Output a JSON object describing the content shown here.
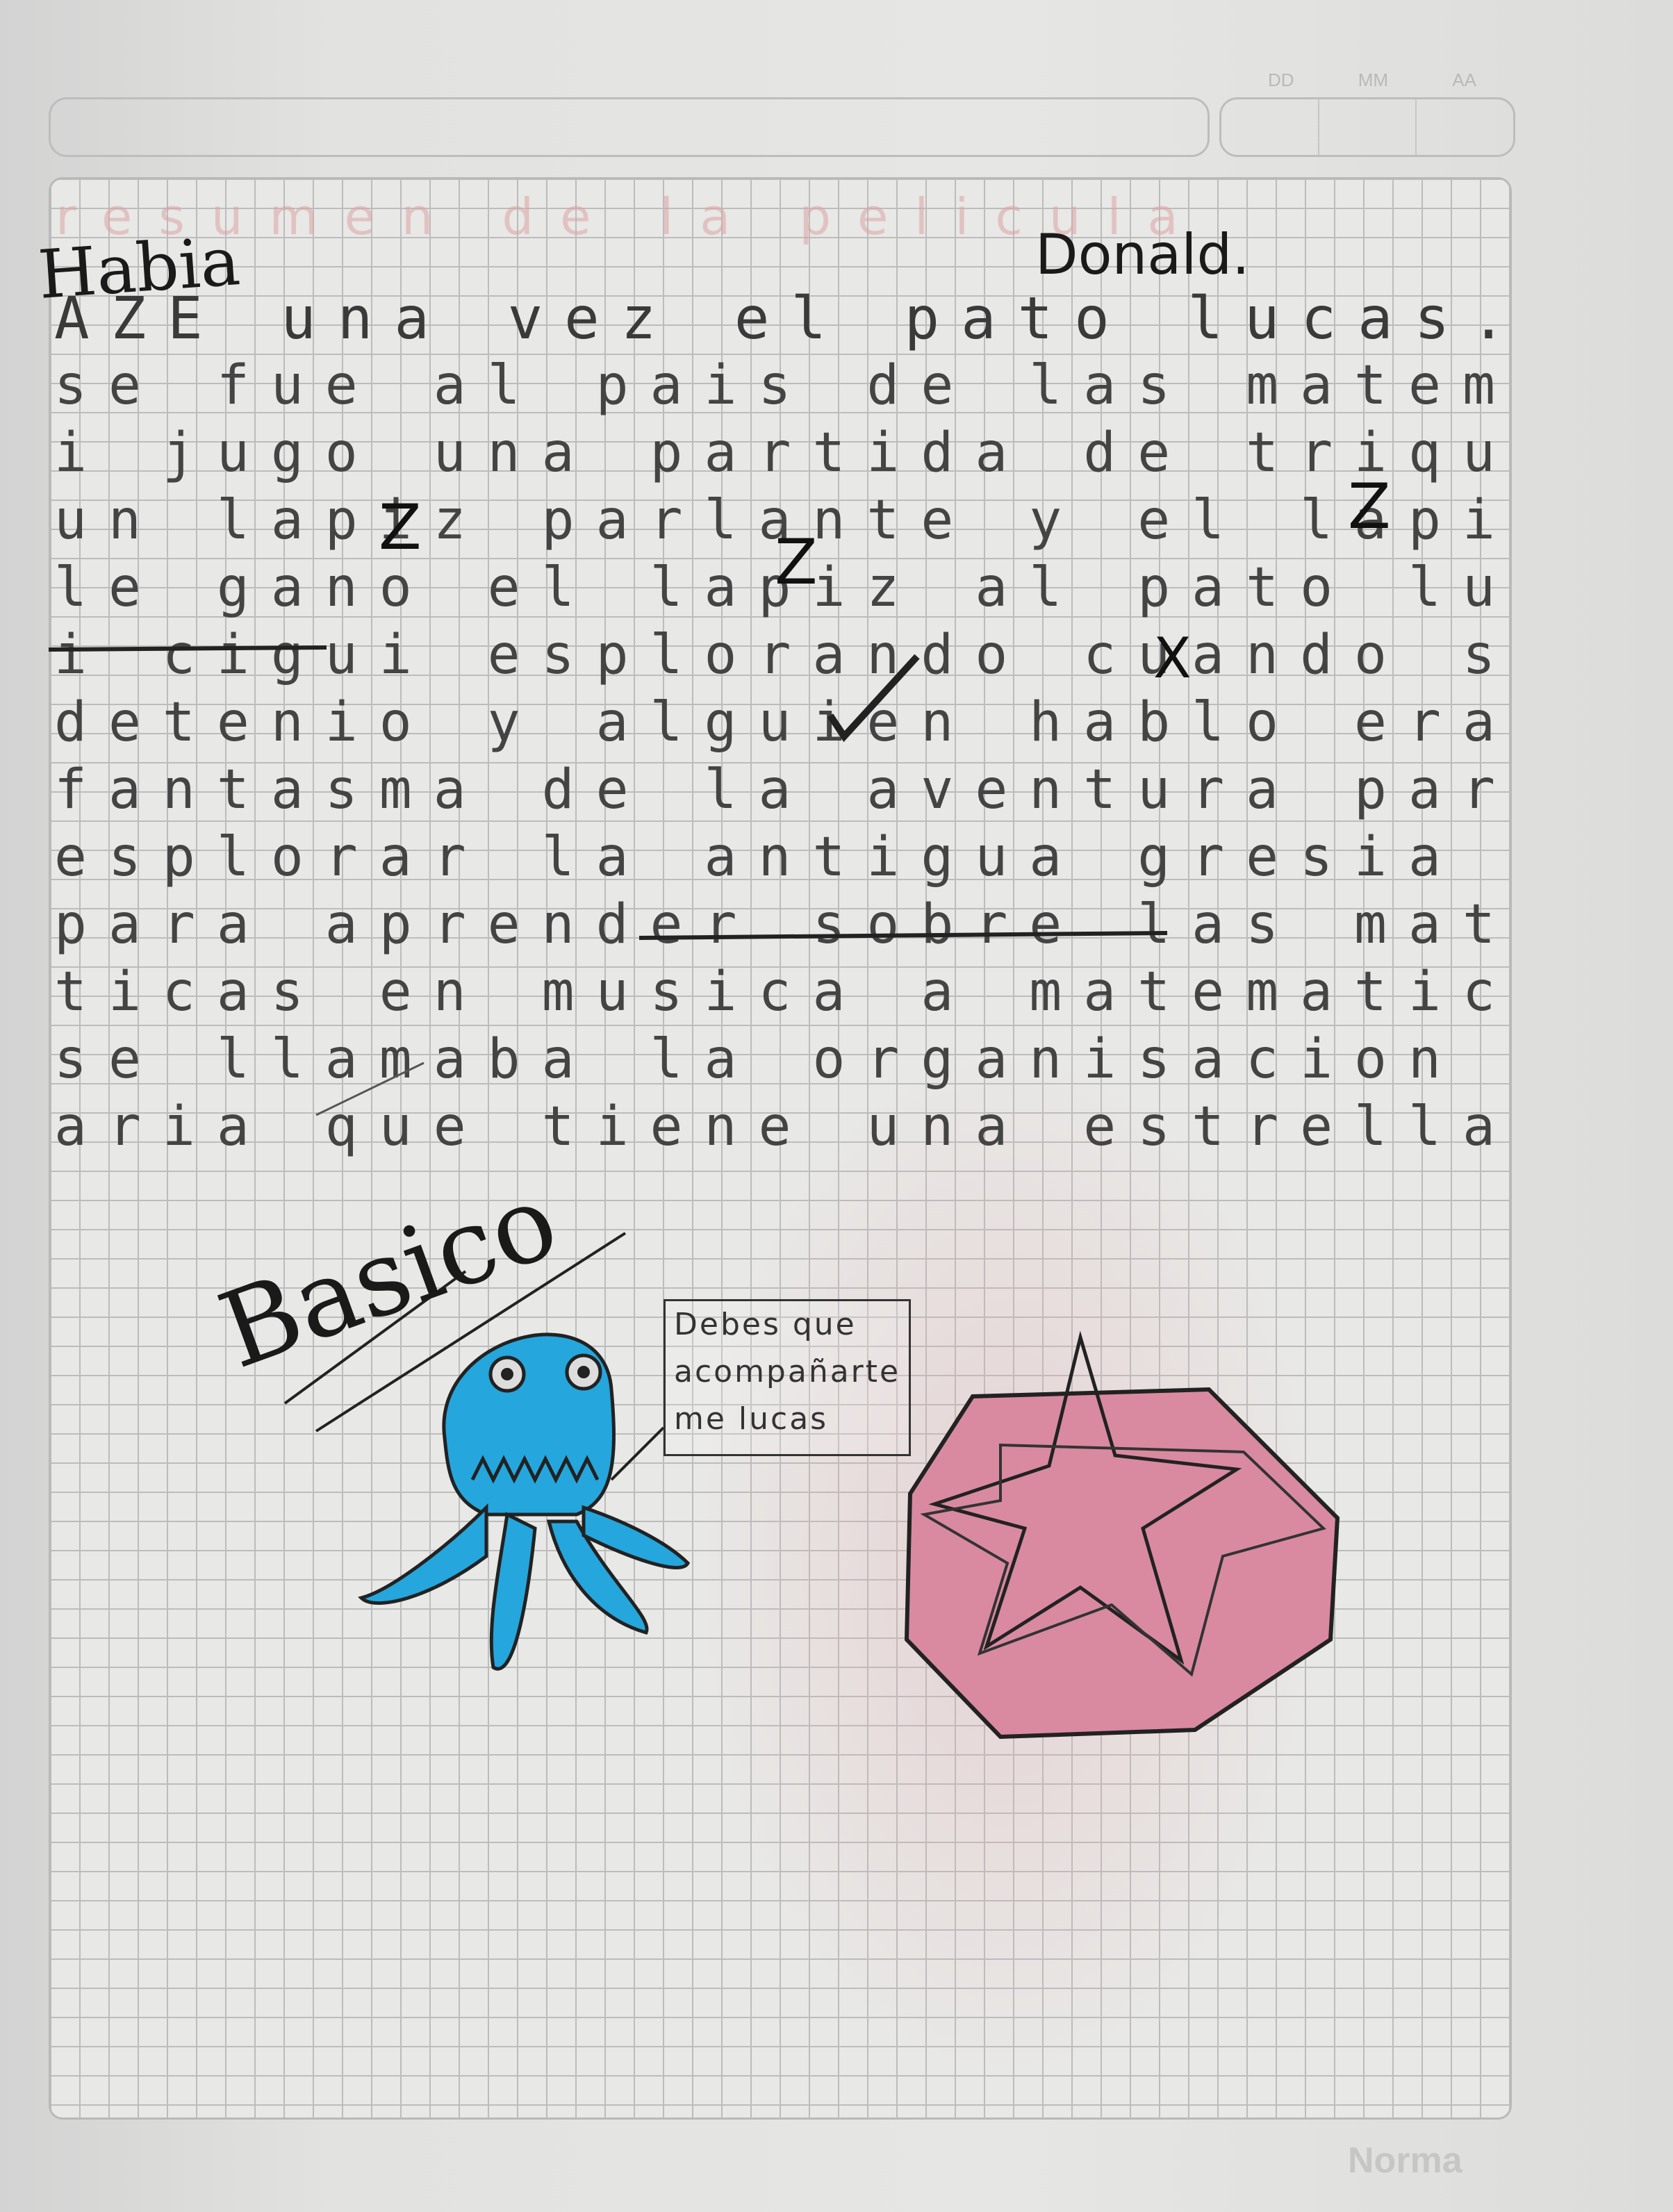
{
  "header": {
    "date_labels": [
      "DD",
      "MM",
      "AA"
    ]
  },
  "page": {
    "bleed_through_title": "resumen de la pelicula",
    "title_word": "Habia",
    "correction_word": "Donald.",
    "story_lines": [
      "AZE una vez el pato lucas.",
      "se fue al pais de las matematicas",
      "i jugo una partida de triqui con",
      "un lapiz parlante y el lapiz",
      "le gano el lapiz al pato lucas",
      "i cigui esplorando cuando se",
      "detenio y alguien hablo era el",
      "fantasma de la aventura para",
      "esplorar la antigua gresia",
      "para aprender sobre las matema",
      "ticas en musica a matematicas",
      "se llamaba la organisacion musi",
      "aria que tiene una estrella."
    ],
    "signature": "Basico",
    "speech_bubble": [
      "Debes que",
      "acompañarte",
      "me lucas"
    ]
  },
  "brand": "Norma",
  "colors": {
    "paper": "#e6e6e4",
    "grid": "#bcbcbc",
    "ink": "#2a2a2a",
    "octopus_blue": "#25a6dc",
    "star_pink": "#d98aa0"
  }
}
